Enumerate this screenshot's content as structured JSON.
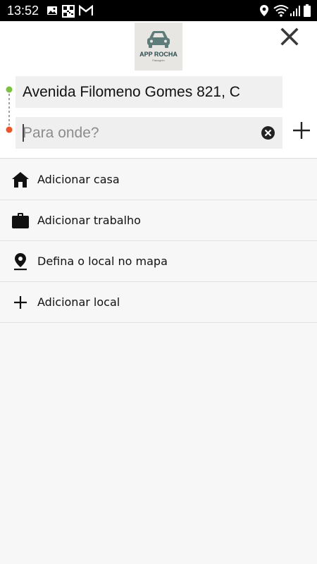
{
  "status_bar": {
    "time": "13:52",
    "notification_icons": [
      "image-icon",
      "qr-app-icon",
      "gmail-icon"
    ],
    "system_icons": [
      "location-icon",
      "wifi-icon",
      "signal-icon",
      "battery-icon"
    ]
  },
  "header": {
    "logo_text": "APP ROCHA",
    "logo_subtext": "Passageiro"
  },
  "route": {
    "origin_value": "Avenida Filomeno Gomes 821, C",
    "destination_value": "",
    "destination_placeholder": "Para onde?",
    "origin_dot_color": "#7cc242",
    "destination_dot_color": "#e8562a"
  },
  "shortcuts": [
    {
      "icon": "home-icon",
      "label": "Adicionar casa"
    },
    {
      "icon": "briefcase-icon",
      "label": "Adicionar trabalho"
    },
    {
      "icon": "map-pin-icon",
      "label": "Defina o local no mapa"
    },
    {
      "icon": "plus-icon",
      "label": "Adicionar local"
    }
  ]
}
